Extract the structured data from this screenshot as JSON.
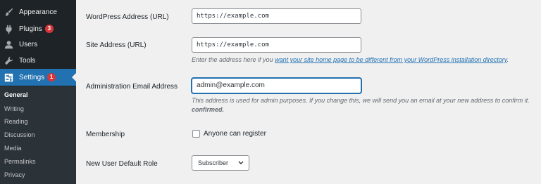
{
  "sidebar": {
    "menu": [
      {
        "label": "Appearance",
        "icon": "paintbrush-icon"
      },
      {
        "label": "Plugins",
        "icon": "plugin-icon",
        "badge": "3"
      },
      {
        "label": "Users",
        "icon": "user-icon"
      },
      {
        "label": "Tools",
        "icon": "wrench-icon"
      },
      {
        "label": "Settings",
        "icon": "settings-icon",
        "badge": "1",
        "active": true
      }
    ],
    "submenu": [
      "General",
      "Writing",
      "Reading",
      "Discussion",
      "Media",
      "Permalinks",
      "Privacy"
    ],
    "current_submenu": "General"
  },
  "form": {
    "wp_address": {
      "label": "WordPress Address (URL)",
      "value": "https://example.com"
    },
    "site_address": {
      "label": "Site Address (URL)",
      "value": "https://example.com",
      "desc_prefix": "Enter the address here if you ",
      "desc_link": "want your site home page to be different from your WordPress installation directory",
      "desc_suffix": "."
    },
    "admin_email": {
      "label": "Administration Email Address",
      "value": "admin@example.com",
      "desc": "This address is used for admin purposes. If you change this, we will send you an email at your new address to confirm it.",
      "desc_bold": "confirmed."
    },
    "membership": {
      "label": "Membership",
      "checkbox_label": "Anyone can register",
      "checked": false
    },
    "default_role": {
      "label": "New User Default Role",
      "value": "Subscriber"
    }
  },
  "colors": {
    "sidebar_bg": "#1d2327",
    "submenu_bg": "#2c3338",
    "accent": "#2271b1",
    "badge": "#d63638",
    "page_bg": "#f0f0f1"
  }
}
